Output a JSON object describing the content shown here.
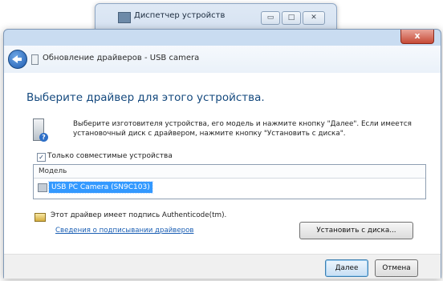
{
  "background_window": {
    "title": "Диспетчер устройств",
    "controls": {
      "minimize": "▭",
      "maximize": "□",
      "close": "✕"
    }
  },
  "dialog": {
    "close_glyph": "x",
    "nav_title": "Обновление драйверов - USB camera",
    "heading": "Выберите драйвер для этого устройства.",
    "description": "Выберите изготовителя устройства, его модель и нажмите кнопку \"Далее\". Если имеется установочный диск с драйвером, нажмите кнопку \"Установить с диска\".",
    "help_glyph": "?",
    "compatible_checkbox": {
      "label": "Только совместимые устройства",
      "checked": true,
      "glyph": "✓"
    },
    "model_list": {
      "header": "Модель",
      "items": [
        {
          "label": "USB PC Camera (SN9C103)",
          "selected": true
        }
      ]
    },
    "signature_text": "Этот драйвер имеет подпись Authenticode(tm).",
    "signature_link": "Сведения о подписывании драйверов",
    "have_disk_button": "Установить с диска...",
    "next_button": "Далее",
    "cancel_button": "Отмена"
  },
  "colors": {
    "heading": "#14497e",
    "link": "#1b5fb4",
    "selection": "#3399ff",
    "close": "#c64a36"
  }
}
